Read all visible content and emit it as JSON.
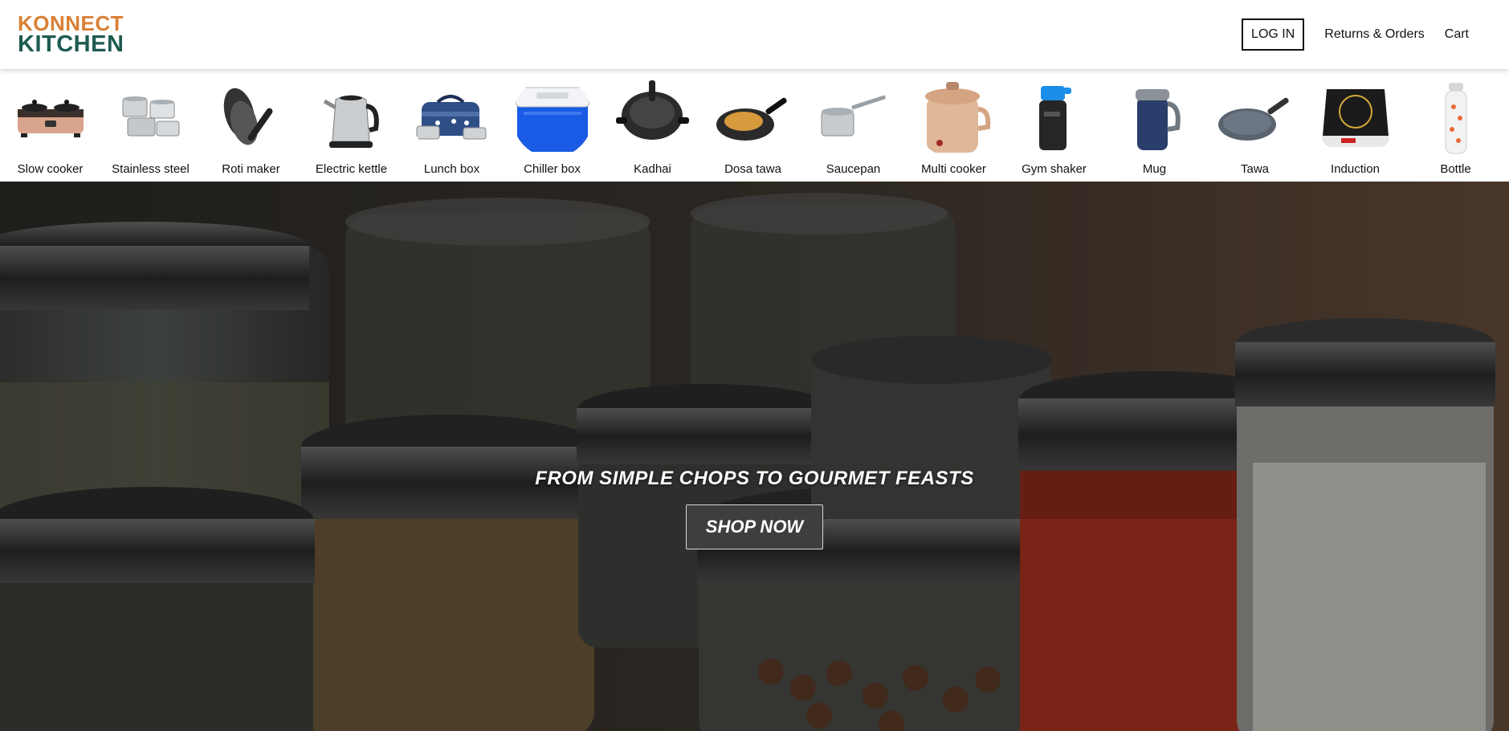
{
  "brand": {
    "line1": "KONNECT",
    "line2": "KITCHEN",
    "accent": "#d98035",
    "dark": "#1e5b52"
  },
  "nav": {
    "login": "LOG IN",
    "returns_orders": "Returns & Orders",
    "cart": "Cart"
  },
  "categories": [
    {
      "label": "Slow cooker",
      "icon": "slow-cooker-icon"
    },
    {
      "label": "Stainless steel",
      "icon": "cookware-set-icon"
    },
    {
      "label": "Roti maker",
      "icon": "roti-maker-icon"
    },
    {
      "label": "Electric kettle",
      "icon": "kettle-icon"
    },
    {
      "label": "Lunch box",
      "icon": "lunch-box-icon"
    },
    {
      "label": "Chiller box",
      "icon": "cooler-icon"
    },
    {
      "label": "Kadhai",
      "icon": "kadhai-icon"
    },
    {
      "label": "Dosa tawa",
      "icon": "dosa-tawa-icon"
    },
    {
      "label": "Saucepan",
      "icon": "saucepan-icon"
    },
    {
      "label": "Multi cooker",
      "icon": "multi-cooker-icon"
    },
    {
      "label": "Gym shaker",
      "icon": "shaker-icon"
    },
    {
      "label": "Mug",
      "icon": "mug-icon"
    },
    {
      "label": "Tawa",
      "icon": "tawa-icon"
    },
    {
      "label": "Induction",
      "icon": "induction-icon"
    },
    {
      "label": "Bottle",
      "icon": "bottle-icon"
    }
  ],
  "hero": {
    "tagline": "FROM SIMPLE CHOPS TO GOURMET FEASTS",
    "cta": "SHOP NOW"
  }
}
